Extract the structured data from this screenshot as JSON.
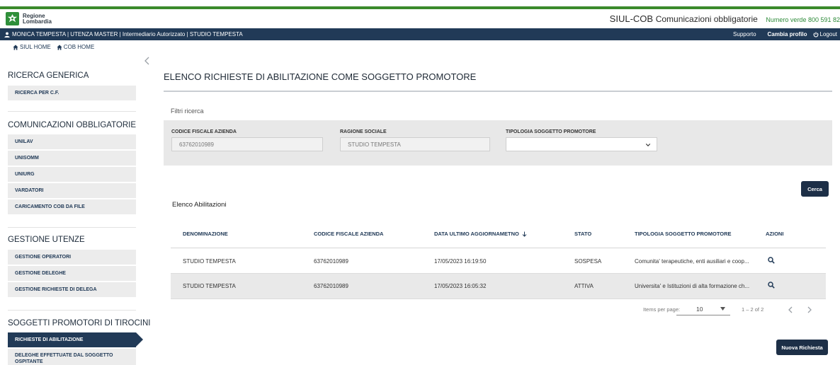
{
  "header": {
    "logo_line1": "Regione",
    "logo_line2": "Lombardia",
    "app_title": "SIUL-COB",
    "app_subtitle": "Comunicazioni obbligatorie",
    "phone_label": "Numero verde 800 591 82"
  },
  "userbar": {
    "user_info": "MONICA TEMPESTA | UTENZA MASTER | Intermediario Autorizzato | STUDIO TEMPESTA",
    "support": "Supporto",
    "change_profile": "Cambia profilo",
    "logout": "Logout"
  },
  "nav": {
    "siul_home": "SIUL HOME",
    "cob_home": "COB HOME"
  },
  "sidebar": {
    "ricerca_title": "RICERCA GENERICA",
    "ricerca_items": [
      "RICERCA PER C.F."
    ],
    "comunicazioni_title": "COMUNICAZIONI OBBLIGATORIE",
    "comunicazioni_items": [
      "UNILAV",
      "UNISOMM",
      "UNIURG",
      "VARDATORI",
      "CARICAMENTO COB DA FILE"
    ],
    "utenze_title": "GESTIONE UTENZE",
    "utenze_items": [
      "GESTIONE OPERATORI",
      "GESTIONE DELEGHE",
      "GESTIONE RICHIESTE DI DELEGA"
    ],
    "promotori_title": "SOGGETTI PROMOTORI DI TIROCINI",
    "promotori_items": [
      "RICHIESTE DI ABILITAZIONE",
      "DELEGHE EFFETTUATE DAL SOGGETTO OSPITANTE"
    ]
  },
  "main": {
    "page_title": "ELENCO RICHIESTE DI ABILITAZIONE COME SOGGETTO PROMOTORE",
    "filters_label": "Filtri ricerca",
    "filters": {
      "cf_label": "CODICE FISCALE AZIENDA",
      "cf_value": "63762010989",
      "ragione_label": "RAGIONE SOCIALE",
      "ragione_value": "STUDIO TEMPESTA",
      "tipologia_label": "TIPOLOGIA SOGGETTO PROMOTORE",
      "tipologia_value": ""
    },
    "search_button": "Cerca",
    "list_title": "Elenco Abilitazioni",
    "table": {
      "columns": [
        "DENOMINAZIONE",
        "CODICE FISCALE AZIENDA",
        "DATA ULTIMO AGGIORNAMETNO",
        "STATO",
        "TIPOLOGIA SOGGETTO PROMOTORE",
        "AZIONI"
      ],
      "sort_column": "DATA ULTIMO AGGIORNAMETNO",
      "rows": [
        [
          "STUDIO TEMPESTA",
          "63762010989",
          "17/05/2023 16:19:50",
          "SOSPESA",
          "Comunita' terapeutiche, enti ausiliari e coop..."
        ],
        [
          "STUDIO TEMPESTA",
          "63762010989",
          "17/05/2023 16:05:32",
          "ATTIVA",
          "Universita' e Istituzioni di alta formazione ch..."
        ]
      ]
    },
    "paginator": {
      "items_label": "Items per page:",
      "page_size": "10",
      "range": "1 – 2 of 2"
    },
    "new_request_button": "Nuova Richiesta"
  },
  "colors": {
    "navy": "#213a57",
    "brand_green": "#3b8a2c",
    "button_dark": "#1d2f47",
    "panel_gray": "#e8e8e8"
  },
  "icons": [
    "user-icon",
    "home-icon",
    "power-icon",
    "chevron-left-icon",
    "chevron-down-icon",
    "sort-arrow-down-icon",
    "search-icon",
    "chevron-right-icon"
  ]
}
